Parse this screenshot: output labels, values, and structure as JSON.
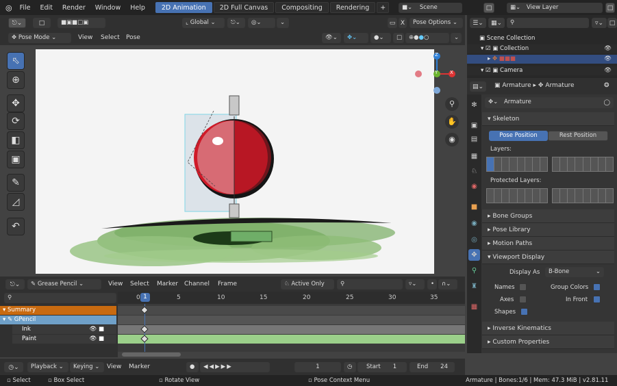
{
  "topbar": {
    "menus": [
      "File",
      "Edit",
      "Render",
      "Window",
      "Help"
    ],
    "workspaces": [
      "2D Animation",
      "2D Full Canvas",
      "Compositing",
      "Rendering"
    ],
    "add_tab": "+",
    "scene": "Scene",
    "view_layer": "View Layer"
  },
  "viewport_header": {
    "mode": "Pose Mode",
    "menus": [
      "View",
      "Select",
      "Pose"
    ],
    "orientation": "Global",
    "pose_options": "Pose Options",
    "x_label": "X"
  },
  "gizmo": {
    "z": "Z",
    "y": "Y",
    "x": "X"
  },
  "outliner": {
    "scene_collection": "Scene Collection",
    "collection": "Collection",
    "camera": "Camera"
  },
  "properties": {
    "breadcrumb_a": "Armature",
    "breadcrumb_b": "Armature",
    "name_field": "Armature",
    "skeleton": "Skeleton",
    "pose_position": "Pose Position",
    "rest_position": "Rest Position",
    "layers": "Layers:",
    "protected_layers": "Protected Layers:",
    "bone_groups": "Bone Groups",
    "pose_library": "Pose Library",
    "motion_paths": "Motion Paths",
    "viewport_display": "Viewport Display",
    "display_as_label": "Display As",
    "display_as_value": "B-Bone",
    "names": "Names",
    "group_colors": "Group Colors",
    "axes": "Axes",
    "in_front": "In Front",
    "shapes": "Shapes",
    "inverse_kinematics": "Inverse Kinematics",
    "custom_properties": "Custom Properties",
    "checks": {
      "names": false,
      "group_colors": true,
      "axes": false,
      "in_front": true,
      "shapes": true
    }
  },
  "dopesheet": {
    "mode": "Grease Pencil",
    "menus": [
      "View",
      "Select",
      "Marker",
      "Channel",
      "Frame"
    ],
    "active_only": "Active Only",
    "frame_ticks": [
      "0",
      "5",
      "10",
      "15",
      "20",
      "25",
      "30",
      "35"
    ],
    "current_frame_badge": "1",
    "channels": [
      "Summary",
      "GPencil",
      "Ink",
      "Paint"
    ]
  },
  "timeline": {
    "playback": "Playback",
    "keying": "Keying",
    "view": "View",
    "marker": "Marker",
    "current_frame": "1",
    "start_label": "Start",
    "start": "1",
    "end_label": "End",
    "end": "24"
  },
  "statusbar": {
    "select": "Select",
    "box_select": "Box Select",
    "rotate_view": "Rotate View",
    "context_menu": "Pose Context Menu",
    "info": "Armature | Bones:1/6 | Mem: 47.3 MiB | v2.81.11"
  },
  "colors": {
    "accent": "#4772b3",
    "summary": "#c86a10",
    "gpencil": "#6fa0c8",
    "ink_row": "#777777",
    "paint_row": "#9bd08a"
  }
}
